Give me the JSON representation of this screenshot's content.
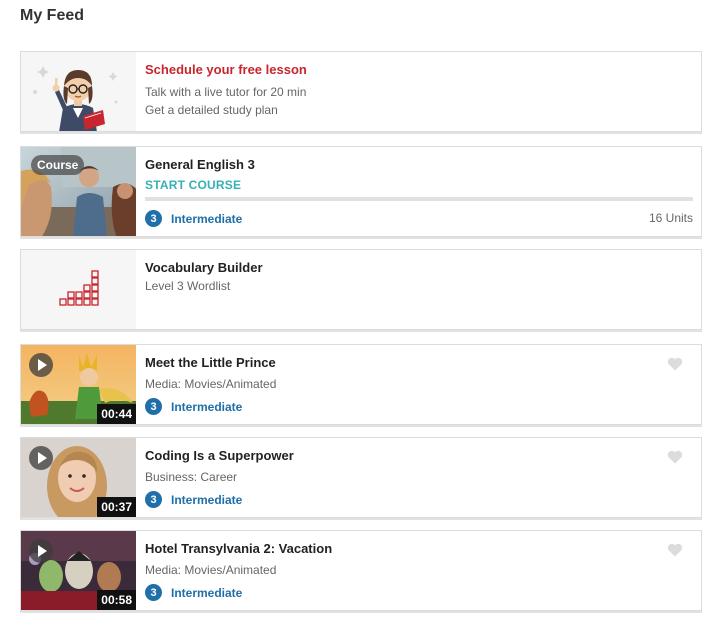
{
  "page": {
    "title": "My Feed"
  },
  "lesson_promo": {
    "title": "Schedule your free lesson",
    "line1": "Talk with a live tutor for 20 min",
    "line2": "Get a detailed study plan",
    "title_color": "#c8262f"
  },
  "course": {
    "badge": "Course",
    "title": "General English 3",
    "action": "START COURSE",
    "progress": 0,
    "level_number": "3",
    "level_label": "Intermediate",
    "units": "16 Units"
  },
  "vocabulary": {
    "title": "Vocabulary Builder",
    "subtitle": "Level 3 Wordlist"
  },
  "videos": [
    {
      "title": "Meet the Little Prince",
      "category": "Media: Movies/Animated",
      "level_number": "3",
      "level_label": "Intermediate",
      "duration": "00:44"
    },
    {
      "title": "Coding Is a Superpower",
      "category": "Business: Career",
      "level_number": "3",
      "level_label": "Intermediate",
      "duration": "00:37"
    },
    {
      "title": "Hotel Transylvania 2: Vacation",
      "category": "Media: Movies/Animated",
      "level_number": "3",
      "level_label": "Intermediate",
      "duration": "00:58"
    }
  ],
  "colors": {
    "accent_teal": "#36b0b8",
    "level_blue": "#1f6fa8",
    "brand_red": "#c8262f"
  },
  "icons": {
    "favorite": "heart-icon",
    "play": "play-icon",
    "vocabulary": "bar-chart-icon"
  }
}
